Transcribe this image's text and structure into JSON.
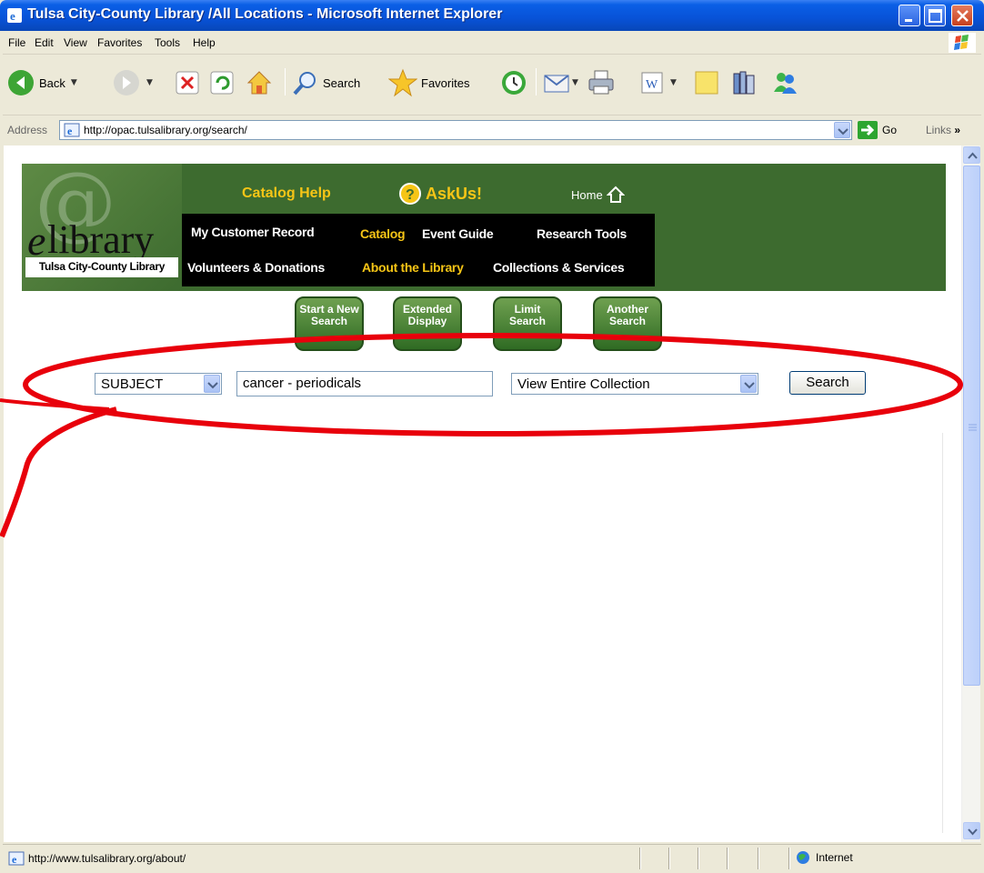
{
  "window": {
    "title": "Tulsa City-County Library /All Locations - Microsoft Internet Explorer"
  },
  "menu": [
    "File",
    "Edit",
    "View",
    "Favorites",
    "Tools",
    "Help"
  ],
  "toolbar": {
    "back_label": "Back",
    "search_label": "Search",
    "favorites_label": "Favorites"
  },
  "address": {
    "label": "Address",
    "url": "http://opac.tulsalibrary.org/search/",
    "go_label": "Go",
    "links_label": "Links"
  },
  "library": {
    "logo_e": "e",
    "logo_word": "library",
    "logo_at": "@",
    "logo_subtitle": "Tulsa City-County Library",
    "catalog_help": "Catalog Help",
    "askus": "AskUs!",
    "home": "Home",
    "nav": {
      "my_customer_record": "My Customer Record",
      "catalog": "Catalog",
      "event_guide": "Event Guide",
      "research_tools": "Research Tools",
      "volunteers": "Volunteers & Donations",
      "about": "About the Library",
      "collections": "Collections & Services"
    },
    "buttons": {
      "start_new_search": "Start a New Search",
      "extended_display": "Extended Display",
      "limit_search": "Limit Search",
      "another_search": "Another Search"
    }
  },
  "search": {
    "type_value": "SUBJECT",
    "query_value": "cancer - periodicals",
    "scope_value": "View Entire Collection",
    "button_label": "Search"
  },
  "status": {
    "url": "http://www.tulsalibrary.org/about/",
    "zone": "Internet"
  },
  "colors": {
    "banner_green": "#3D6B2F",
    "active_nav": "#F6C516",
    "annotation_red": "#E8000B"
  }
}
